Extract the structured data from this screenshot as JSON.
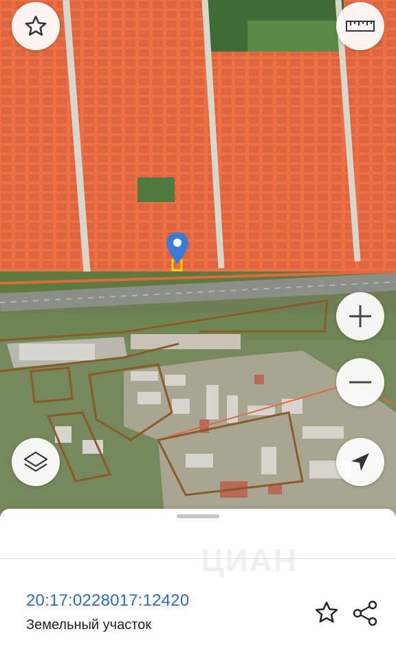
{
  "map": {
    "controls": {
      "favorites_icon": "star-icon",
      "ruler_icon": "ruler-icon",
      "zoom_in_icon": "plus-icon",
      "zoom_out_icon": "minus-icon",
      "layers_icon": "layers-icon",
      "locate_icon": "navigation-arrow-icon"
    },
    "marker_color": "#3a7bd5",
    "selected_parcel_color": "#ffd400",
    "parcel_overlay_color": "#ff6a3d"
  },
  "sheet": {
    "watermark": "ЦИАН",
    "cadastral_number": "20:17:0228017:12420",
    "object_type": "Земельный участок",
    "favorite_icon": "star-outline-icon",
    "share_icon": "share-icon"
  }
}
